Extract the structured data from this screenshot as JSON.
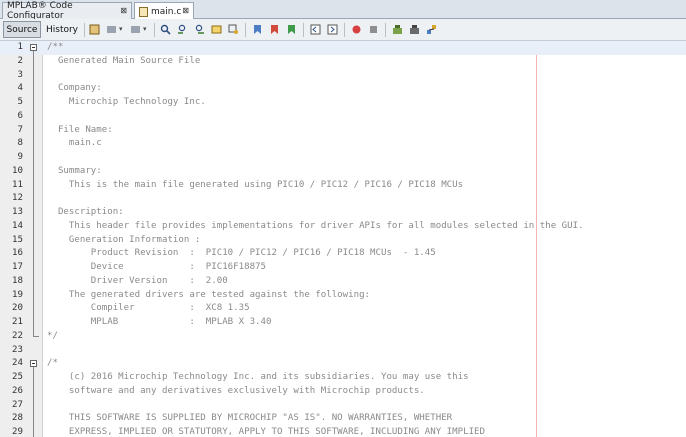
{
  "tabs": [
    {
      "label": "MPLAB® Code Configurator",
      "close": "⊠"
    },
    {
      "label": "main.c",
      "close": "⊠"
    }
  ],
  "toolbar": {
    "source_label": "Source",
    "history_label": "History"
  },
  "editor": {
    "lines": [
      {
        "n": "1",
        "text": "/**"
      },
      {
        "n": "2",
        "text": "  Generated Main Source File"
      },
      {
        "n": "3",
        "text": ""
      },
      {
        "n": "4",
        "text": "  Company:"
      },
      {
        "n": "5",
        "text": "    Microchip Technology Inc."
      },
      {
        "n": "6",
        "text": ""
      },
      {
        "n": "7",
        "text": "  File Name:"
      },
      {
        "n": "8",
        "text": "    main.c"
      },
      {
        "n": "9",
        "text": ""
      },
      {
        "n": "10",
        "text": "  Summary:"
      },
      {
        "n": "11",
        "text": "    This is the main file generated using PIC10 / PIC12 / PIC16 / PIC18 MCUs"
      },
      {
        "n": "12",
        "text": ""
      },
      {
        "n": "13",
        "text": "  Description:"
      },
      {
        "n": "14",
        "text": "    This header file provides implementations for driver APIs for all modules selected in the GUI."
      },
      {
        "n": "15",
        "text": "    Generation Information :"
      },
      {
        "n": "16",
        "text": "        Product Revision  :  PIC10 / PIC12 / PIC16 / PIC18 MCUs  - 1.45"
      },
      {
        "n": "17",
        "text": "        Device            :  PIC16F18875"
      },
      {
        "n": "18",
        "text": "        Driver Version    :  2.00"
      },
      {
        "n": "19",
        "text": "    The generated drivers are tested against the following:"
      },
      {
        "n": "20",
        "text": "        Compiler          :  XC8 1.35"
      },
      {
        "n": "21",
        "text": "        MPLAB             :  MPLAB X 3.40"
      },
      {
        "n": "22",
        "text": "*/"
      },
      {
        "n": "23",
        "text": ""
      },
      {
        "n": "24",
        "text": "/*"
      },
      {
        "n": "25",
        "text": "    (c) 2016 Microchip Technology Inc. and its subsidiaries. You may use this"
      },
      {
        "n": "26",
        "text": "    software and any derivatives exclusively with Microchip products."
      },
      {
        "n": "27",
        "text": ""
      },
      {
        "n": "28",
        "text": "    THIS SOFTWARE IS SUPPLIED BY MICROCHIP \"AS IS\". NO WARRANTIES, WHETHER"
      },
      {
        "n": "29",
        "text": "    EXPRESS, IMPLIED OR STATUTORY, APPLY TO THIS SOFTWARE, INCLUDING ANY IMPLIED"
      }
    ]
  },
  "icons": [
    "fold-collapse-icon",
    "find-icon",
    "toggle-bookmark-icon",
    "record-macro-icon",
    "stop-macro-icon"
  ],
  "colors": {
    "comment": "#8a8a8a",
    "margin_line": "#f2b3b3",
    "current_line": "#e9eff8"
  }
}
